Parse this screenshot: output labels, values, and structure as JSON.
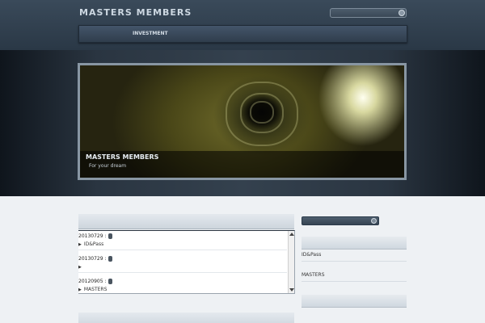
{
  "header": {
    "site_title": "MASTERS MEMBERS",
    "nav_items": [
      {
        "label": "INVESTMENT"
      }
    ]
  },
  "banner": {
    "caption_title": "MASTERS MEMBERS",
    "caption_subtitle": "For your dream"
  },
  "news": {
    "entries": [
      {
        "date": "20130729 :",
        "link": "ID&Pass"
      },
      {
        "date": "20130729 :",
        "link": ""
      },
      {
        "date": "20120905 :",
        "link": "MASTERS"
      }
    ]
  },
  "sidebar": {
    "links": [
      {
        "label": "ID&Pass"
      },
      {
        "label": "MASTERS"
      }
    ]
  },
  "colors": {
    "header_bg": "#2f3d4c",
    "accent_dark": "#2a3440",
    "page_bg": "#eef1f4"
  },
  "icons": {
    "search": "search-icon",
    "news_bullet": "triangle-right-icon"
  }
}
